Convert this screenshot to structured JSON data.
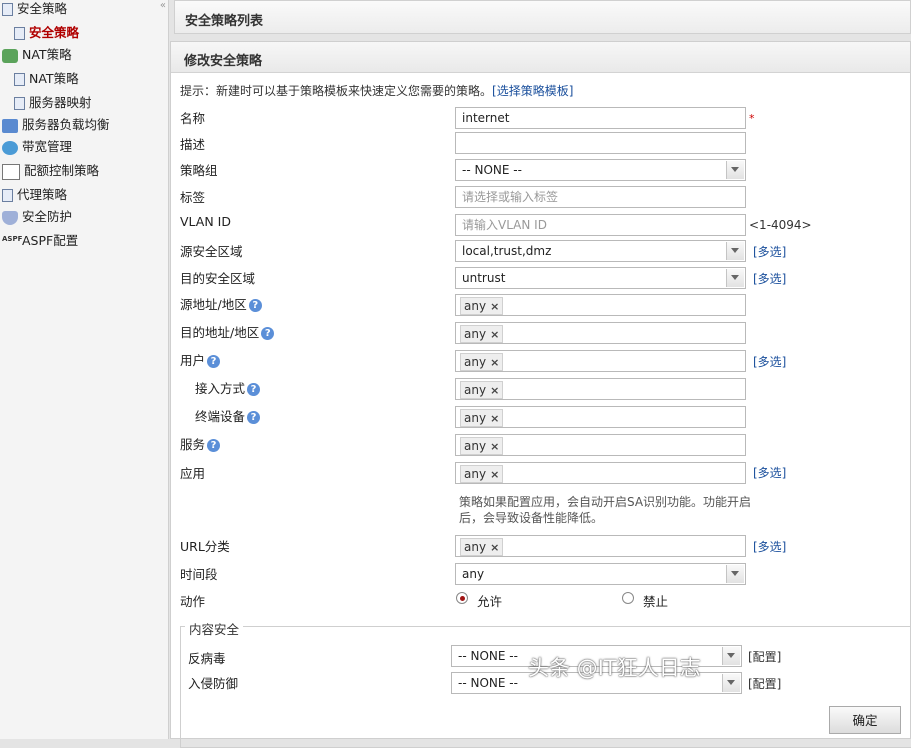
{
  "sidebar": {
    "collapse": "«",
    "items": [
      {
        "label": "安全策略"
      },
      {
        "label": "安全策略"
      },
      {
        "label": "NAT策略"
      },
      {
        "label": "NAT策略"
      },
      {
        "label": "服务器映射"
      },
      {
        "label": "服务器负载均衡"
      },
      {
        "label": "带宽管理"
      },
      {
        "label": "配额控制策略"
      },
      {
        "label": "代理策略"
      },
      {
        "label": "安全防护"
      },
      {
        "label": "ASPF配置"
      }
    ],
    "aspf_icon_text": "ASPF"
  },
  "top_panel": {
    "title": "安全策略列表"
  },
  "form": {
    "title": "修改安全策略",
    "hint": "提示：新建时可以基于策略模板来快速定义您需要的策略。",
    "hint_link": "[选择策略模板]",
    "required_mark": "*",
    "multi": "[多选]",
    "name": {
      "label": "名称",
      "value": "internet"
    },
    "desc": {
      "label": "描述",
      "value": ""
    },
    "group": {
      "label": "策略组",
      "value": "-- NONE --"
    },
    "tag": {
      "label": "标签",
      "placeholder": "请选择或输入标签"
    },
    "vlan": {
      "label": "VLAN ID",
      "placeholder": "请输入VLAN ID",
      "range": "<1-4094>"
    },
    "src_zone": {
      "label": "源安全区域",
      "value": "local,trust,dmz"
    },
    "dst_zone": {
      "label": "目的安全区域",
      "value": "untrust"
    },
    "src_addr": {
      "label": "源地址/地区",
      "tag": "any"
    },
    "dst_addr": {
      "label": "目的地址/地区",
      "tag": "any"
    },
    "user": {
      "label": "用户",
      "tag": "any"
    },
    "access": {
      "label": "接入方式",
      "tag": "any"
    },
    "device": {
      "label": "终端设备",
      "tag": "any"
    },
    "service": {
      "label": "服务",
      "tag": "any"
    },
    "app": {
      "label": "应用",
      "tag": "any"
    },
    "app_note": "策略如果配置应用，会自动开启SA识别功能。功能开启后，会导致设备性能降低。",
    "url": {
      "label": "URL分类",
      "tag": "any"
    },
    "time": {
      "label": "时间段",
      "value": "any"
    },
    "action": {
      "label": "动作",
      "allow": "允许",
      "deny": "禁止",
      "selected": "allow"
    },
    "content": {
      "legend": "内容安全",
      "config": "[配置]",
      "antivirus": {
        "label": "反病毒",
        "value": "-- NONE --"
      },
      "ips": {
        "label": "入侵防御",
        "value": "-- NONE --"
      }
    },
    "ok_button": "确定",
    "tag_remove": "×",
    "help": "?"
  },
  "watermark": "头条 @IT狂人日志"
}
